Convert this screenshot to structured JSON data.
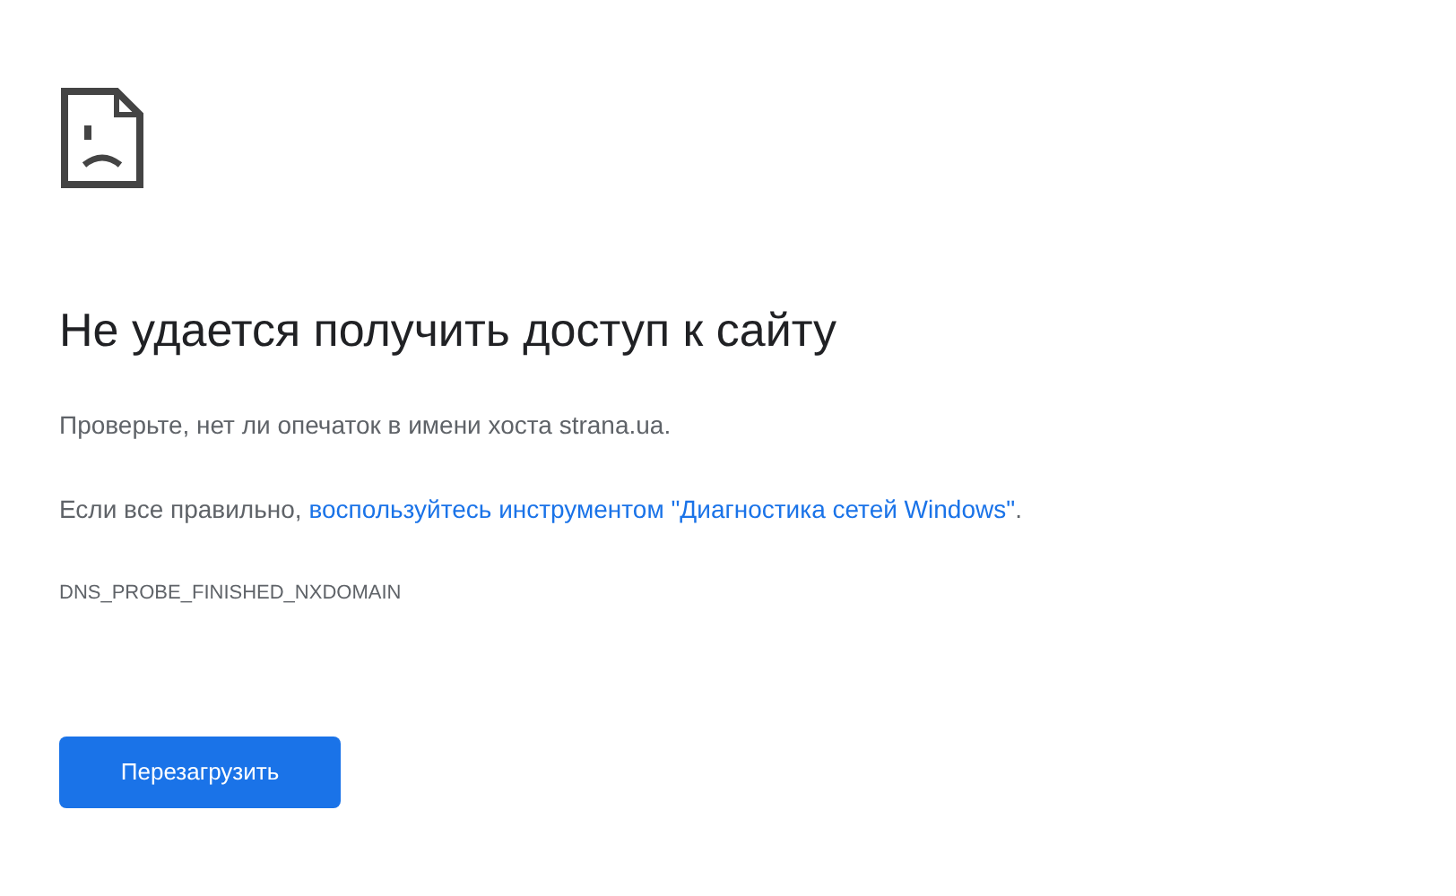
{
  "heading": "Не удается получить доступ к сайту",
  "hint": "Проверьте, нет ли опечаток в имени хоста strana.ua.",
  "suggestion": {
    "before": "Если все правильно, ",
    "link": "воспользуйтесь инструментом \"Диагностика сетей Windows\"",
    "after": "."
  },
  "error_code": "DNS_PROBE_FINISHED_NXDOMAIN",
  "button": "Перезагрузить"
}
